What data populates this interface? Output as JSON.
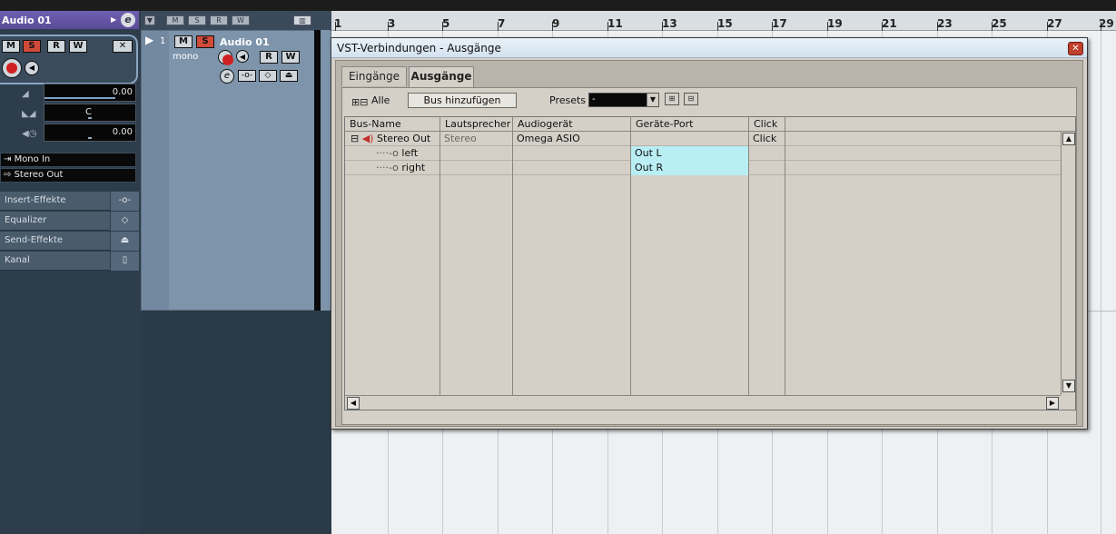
{
  "inspector": {
    "track_name": "Audio 01",
    "btn_m": "M",
    "btn_s": "S",
    "btn_r": "R",
    "btn_w": "W",
    "volume_value": "0.00",
    "pan_value": "C",
    "delay_value": "0.00",
    "input_routing": "Mono In",
    "output_routing": "Stereo Out",
    "sections": [
      {
        "label": "Insert-Effekte"
      },
      {
        "label": "Equalizer"
      },
      {
        "label": "Send-Effekte"
      },
      {
        "label": "Kanal"
      }
    ]
  },
  "tracklist": {
    "toolbar_chips": [
      "M",
      "S",
      "R",
      "W"
    ],
    "track_number": "1",
    "track_name": "Audio 01",
    "track_type": "mono",
    "btn_m": "M",
    "btn_s": "S",
    "btn_r": "R",
    "btn_w": "W"
  },
  "ruler": {
    "bars": [
      "1",
      "3",
      "5",
      "7",
      "9",
      "11",
      "13",
      "15",
      "17",
      "19",
      "21",
      "23",
      "25",
      "27",
      "29"
    ]
  },
  "dialog": {
    "title": "VST-Verbindungen - Ausgänge",
    "tabs": [
      {
        "label": "Eingänge",
        "active": false
      },
      {
        "label": "Ausgänge",
        "active": true
      }
    ],
    "toolbar": {
      "all_label": "Alle",
      "add_bus_label": "Bus hinzufügen",
      "presets_label": "Presets",
      "presets_value": "-"
    },
    "columns": [
      "Bus-Name",
      "Lautsprecher",
      "Audiogerät",
      "Geräte-Port",
      "Click"
    ],
    "rows": [
      {
        "bus_name": "Stereo Out",
        "speaker": "Stereo",
        "device": "Omega ASIO",
        "port": "",
        "click": "Click"
      },
      {
        "bus_name": "left",
        "speaker": "",
        "device": "",
        "port": "Out L",
        "click": ""
      },
      {
        "bus_name": "right",
        "speaker": "",
        "device": "",
        "port": "Out R",
        "click": ""
      }
    ]
  },
  "colors": {
    "accent_header": "#6f5fb0",
    "port_highlight": "#b8eef4",
    "solo_red": "#d04a3a"
  }
}
